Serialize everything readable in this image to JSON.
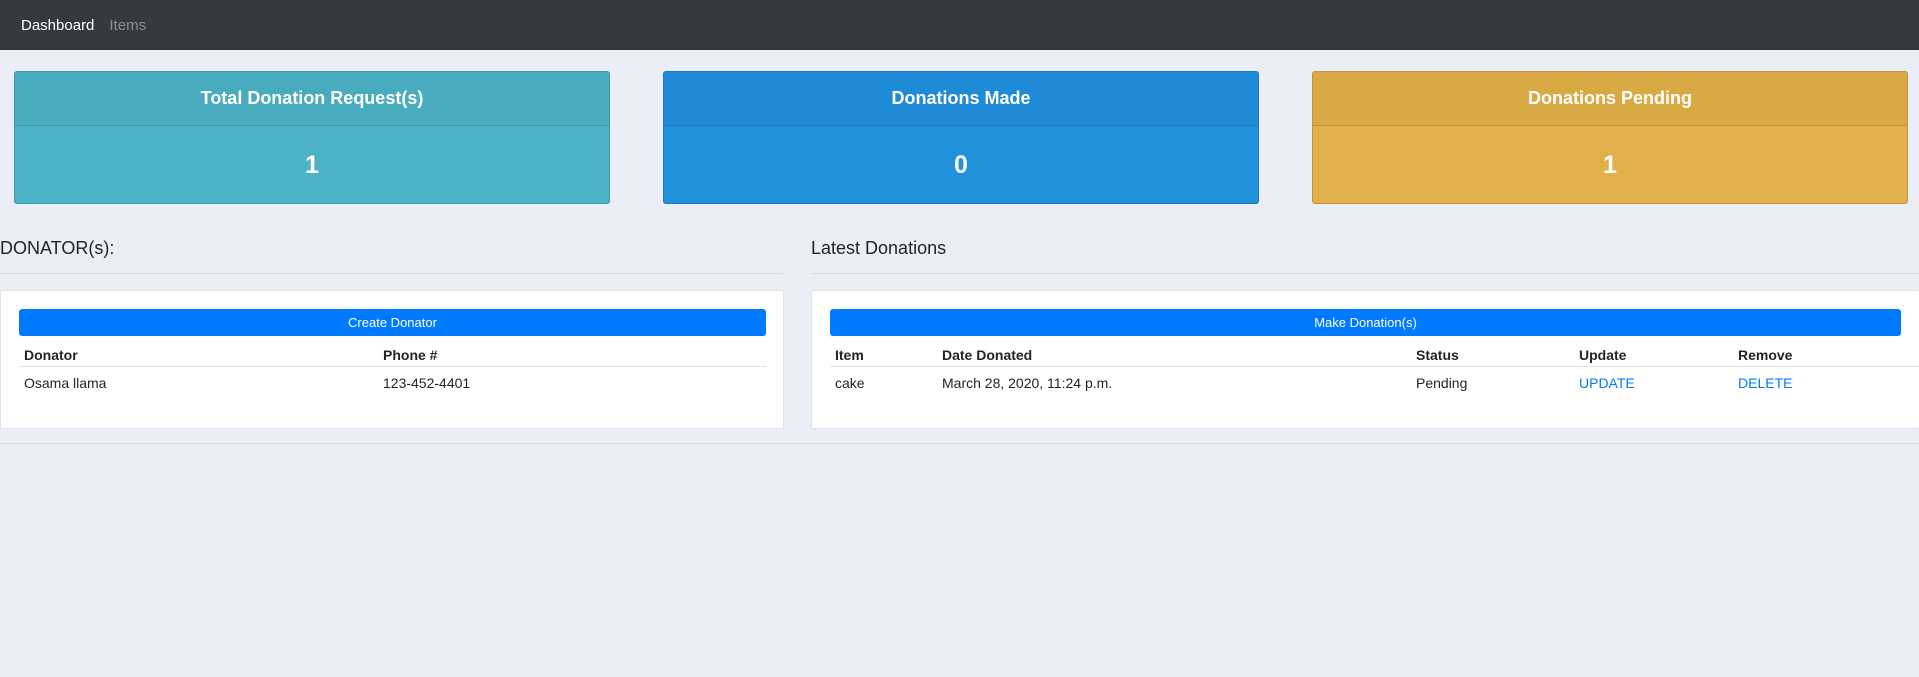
{
  "nav": {
    "items": [
      {
        "label": "Dashboard",
        "active": true
      },
      {
        "label": "Items",
        "active": false
      }
    ]
  },
  "stats": [
    {
      "title": "Total Donation Request(s)",
      "value": "1",
      "color": "#4cb3c6"
    },
    {
      "title": "Donations Made",
      "value": "0",
      "color": "#2191dc"
    },
    {
      "title": "Donations Pending",
      "value": "1",
      "color": "#e1b04a"
    }
  ],
  "donators": {
    "title": "DONATOR(s):",
    "button_label": "Create Donator",
    "columns": [
      "Donator",
      "Phone #"
    ],
    "rows": [
      {
        "name": "Osama llama",
        "phone": "123-452-4401"
      }
    ]
  },
  "donations": {
    "title": "Latest Donations",
    "button_label": "Make Donation(s)",
    "columns": [
      "Item",
      "Date Donated",
      "Status",
      "Update",
      "Remove"
    ],
    "rows": [
      {
        "item": "cake",
        "date": "March 28, 2020, 11:24 p.m.",
        "status": "Pending",
        "update": "UPDATE",
        "remove": "DELETE"
      }
    ]
  },
  "colors": {
    "navbar": "#343a40",
    "primary": "#007bff",
    "background": "#ebeef6"
  }
}
